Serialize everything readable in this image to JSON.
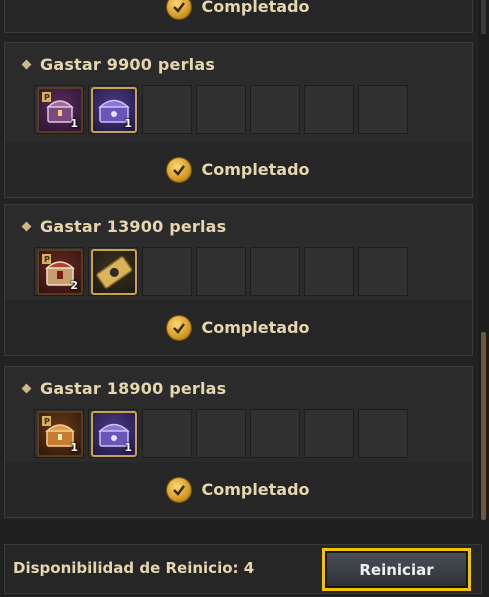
{
  "top_partial": {
    "status": "Completado"
  },
  "cards": [
    {
      "title": "Gastar 9900 perlas",
      "status": "Completado",
      "rewards": [
        {
          "icon": "purple-chest-icon",
          "count": "1"
        },
        {
          "icon": "purple-chest-icon",
          "count": "1"
        }
      ],
      "empty_slots": 5
    },
    {
      "title": "Gastar 13900 perlas",
      "status": "Completado",
      "rewards": [
        {
          "icon": "red-chest-icon",
          "count": "2"
        },
        {
          "icon": "gold-ticket-icon",
          "count": ""
        }
      ],
      "empty_slots": 5
    },
    {
      "title": "Gastar 18900 perlas",
      "status": "Completado",
      "rewards": [
        {
          "icon": "gold-chest-icon",
          "count": "1"
        },
        {
          "icon": "purple-chest-icon",
          "count": "1"
        }
      ],
      "empty_slots": 5
    }
  ],
  "footer": {
    "reset_label": "Disponibilidad de Reinicio: 4",
    "reset_button": "Reiniciar"
  },
  "colors": {
    "accent": "#f2c400",
    "text": "#e6d6b0"
  }
}
